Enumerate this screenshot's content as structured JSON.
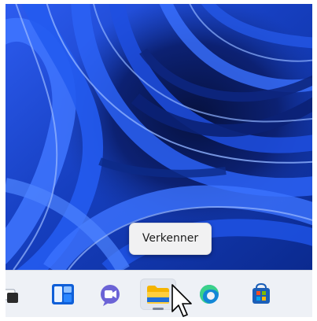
{
  "desktop": {
    "wallpaper": "windows-11-bloom-swirl",
    "colors": {
      "deep_blue": "#0a1f6a",
      "mid_blue": "#1b45c8",
      "light_blue": "#4f86ff"
    }
  },
  "tooltip": {
    "text": "Verkenner"
  },
  "taskbar": {
    "background": "#eef1f6",
    "items": [
      {
        "name": "task-view",
        "icon": "task-view-icon"
      },
      {
        "name": "widgets",
        "icon": "widgets-icon"
      },
      {
        "name": "chat",
        "icon": "teams-chat-icon"
      },
      {
        "name": "file-explorer",
        "icon": "folder-icon",
        "active": true
      },
      {
        "name": "edge",
        "icon": "edge-icon"
      },
      {
        "name": "store",
        "icon": "store-icon"
      }
    ]
  },
  "cursor": {
    "icon": "mouse-pointer-icon"
  }
}
